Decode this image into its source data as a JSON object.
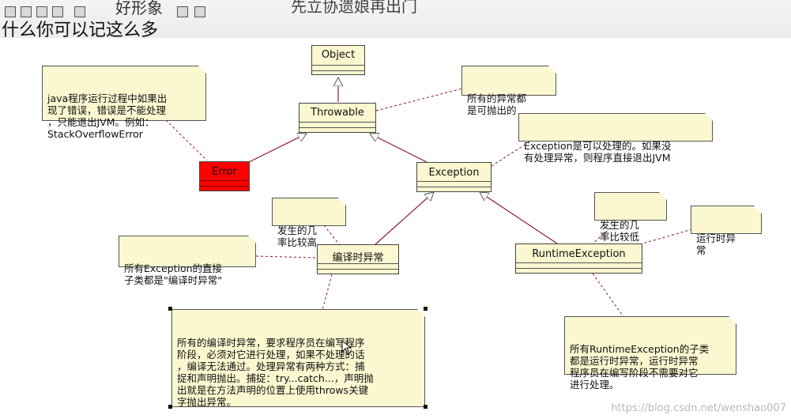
{
  "overlay": {
    "subtitle_left": "好形象",
    "subtitle_center": "先立协遗娘再出门",
    "subtitle_line2": "什么你可以记这么多"
  },
  "classes": {
    "object": "Object",
    "throwable": "Throwable",
    "error": "Error",
    "exception": "Exception",
    "checked": "编译时异常",
    "runtime": "RuntimeException"
  },
  "notes": {
    "error_note": "java程序运行过程中如果出\n现了错误，错误是不能处理\n，只能退出JVM。例如：\nStackOverflowError",
    "throwable_note": "所有的异常都\n是可抛出的",
    "exception_note": "Exception是可以处理的。如果没\n有处理异常，则程序直接退出JVM",
    "checked_freq": "发生的几\n率比较高",
    "checked_direct": "所有Exception的直接\n子类都是\"编译时异常\"",
    "checked_desc": "所有的编译时异常，要求程序员在编写程序\n阶段，必须对它进行处理，如果不处理的话\n，编译无法通过。处理异常有两种方式：捕\n捉和声明抛出。捕捉：try...catch...，声明抛\n出就是在方法声明的位置上使用throws关键\n字抛出异常。",
    "runtime_freq": "发生的几\n率比较低",
    "runtime_label": "运行时异\n常",
    "runtime_desc": "所有RuntimeException的子类\n都是运行时异常，运行时异常\n程序员在编写阶段不需要对它\n进行处理。"
  },
  "colors": {
    "note_fill": "#fbf7d0",
    "error_fill": "#ff0000",
    "link_color": "#8b1a2b"
  },
  "watermark": "https://blog.csdn.net/wenshao007"
}
